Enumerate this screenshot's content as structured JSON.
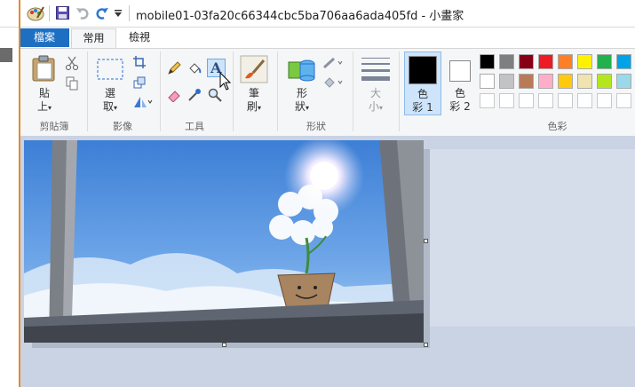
{
  "window": {
    "title": "mobile01-03fa20c66344cbc5ba706aa6ada405fd - 小畫家"
  },
  "quick_access": {
    "icons": [
      "paint-app-icon",
      "save-icon",
      "undo-icon",
      "redo-icon",
      "customize-dropdown-icon"
    ]
  },
  "tabs": [
    {
      "label": "檔案"
    },
    {
      "label": "常用"
    },
    {
      "label": "檢視"
    }
  ],
  "ribbon": {
    "clipboard": {
      "paste_label_1": "貼",
      "paste_label_2": "上",
      "group_label": "剪貼簿"
    },
    "image": {
      "select_label_1": "選",
      "select_label_2": "取",
      "group_label": "影像"
    },
    "tools": {
      "group_label": "工具"
    },
    "brushes": {
      "label_1": "筆",
      "label_2": "刷"
    },
    "shapes": {
      "label_1": "形",
      "label_2": "狀",
      "group_label": "形狀"
    },
    "size": {
      "label_1": "大",
      "label_2": "小"
    },
    "color1": {
      "label_1": "色",
      "label_2": "彩 1"
    },
    "color2": {
      "label_1": "色",
      "label_2": "彩 2"
    },
    "colors": {
      "group_label": "色彩",
      "row1": [
        "#000000",
        "#7f7f7f",
        "#880015",
        "#ed1c24",
        "#ff7f27",
        "#fff200",
        "#22b14c",
        "#00a2e8"
      ],
      "row2": [
        "#ffffff",
        "#c3c3c3",
        "#b97a57",
        "#ffaec9",
        "#ffc90e",
        "#efe4b0",
        "#b5e61d",
        "#99d9ea"
      ]
    }
  }
}
